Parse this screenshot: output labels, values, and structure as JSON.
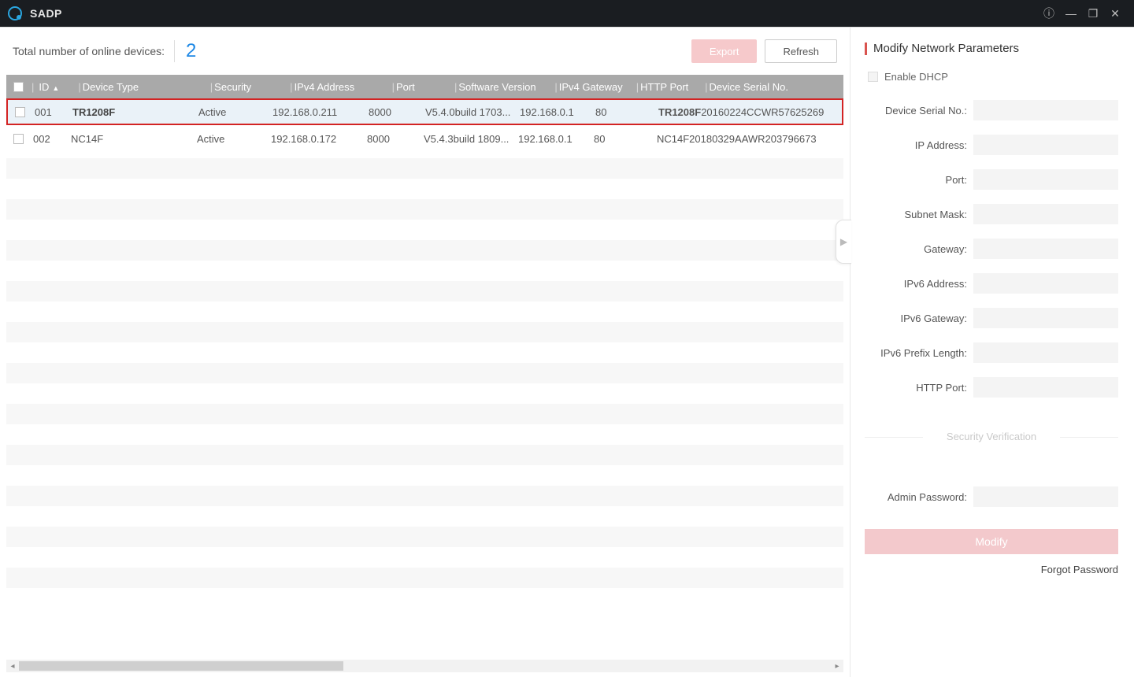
{
  "app": {
    "title": "SADP"
  },
  "toolbar": {
    "total_label": "Total number of online devices:",
    "total_count": "2",
    "export_label": "Export",
    "refresh_label": "Refresh"
  },
  "table": {
    "headers": {
      "id": "ID",
      "device_type": "Device Type",
      "security": "Security",
      "ipv4_address": "IPv4 Address",
      "port": "Port",
      "software_version": "Software Version",
      "ipv4_gateway": "IPv4 Gateway",
      "http_port": "HTTP Port",
      "serial": "Device Serial No."
    },
    "rows": [
      {
        "id": "001",
        "device_type": "TR1208F",
        "security": "Active",
        "ipv4_address": "192.168.0.211",
        "port": "8000",
        "software_version": "V5.4.0build 1703...",
        "ipv4_gateway": "192.168.0.1",
        "http_port": "80",
        "serial_prefix": "TR1208F",
        "serial_suffix": "20160224CCWR57625269",
        "highlight": true
      },
      {
        "id": "002",
        "device_type": "NC14F",
        "security": "Active",
        "ipv4_address": "192.168.0.172",
        "port": "8000",
        "software_version": "V5.4.3build 1809...",
        "ipv4_gateway": "192.168.0.1",
        "http_port": "80",
        "serial_prefix": "",
        "serial_suffix": "NC14F20180329AAWR203796673",
        "highlight": false
      }
    ]
  },
  "panel": {
    "title": "Modify Network Parameters",
    "enable_dhcp": "Enable DHCP",
    "fields": {
      "serial": "Device Serial No.:",
      "ip": "IP Address:",
      "port": "Port:",
      "subnet": "Subnet Mask:",
      "gateway": "Gateway:",
      "ipv6_addr": "IPv6 Address:",
      "ipv6_gw": "IPv6 Gateway:",
      "ipv6_prefix": "IPv6 Prefix Length:",
      "http_port": "HTTP Port:",
      "admin_pw": "Admin Password:"
    },
    "security_verification": "Security Verification",
    "modify_label": "Modify",
    "forgot_label": "Forgot Password"
  }
}
